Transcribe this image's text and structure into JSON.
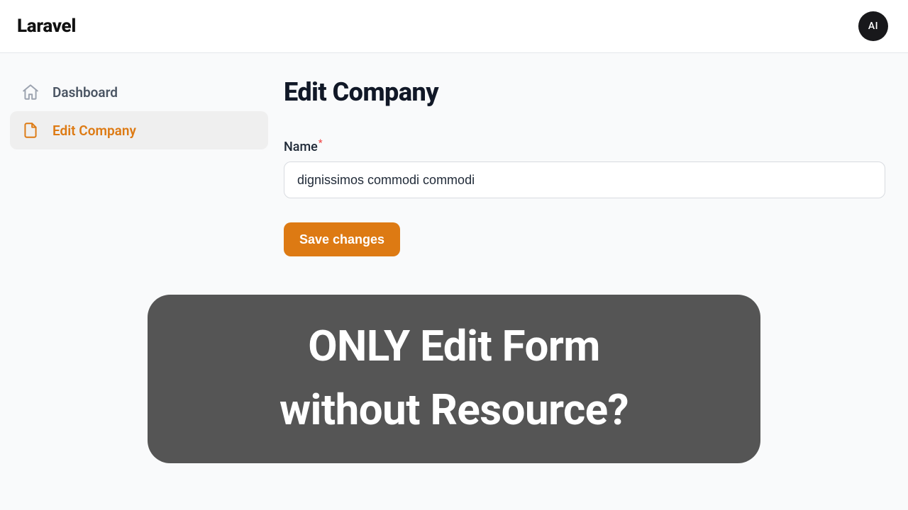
{
  "header": {
    "brand": "Laravel",
    "avatar_initials": "AI"
  },
  "sidebar": {
    "items": [
      {
        "label": "Dashboard",
        "active": false
      },
      {
        "label": "Edit Company",
        "active": true
      }
    ]
  },
  "page": {
    "title": "Edit Company"
  },
  "form": {
    "name_label": "Name",
    "name_required_mark": "*",
    "name_value": "dignissimos commodi commodi",
    "save_label": "Save changes"
  },
  "overlay": {
    "line1": "ONLY Edit Form",
    "line2": "without Resource?"
  },
  "colors": {
    "accent": "#dd7a13"
  }
}
